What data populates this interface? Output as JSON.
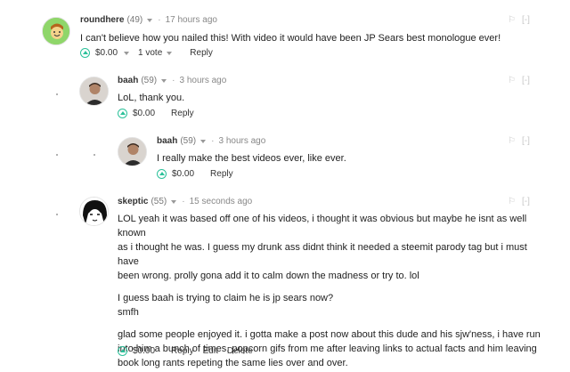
{
  "comments": [
    {
      "author": "roundhere",
      "reputation": "(49)",
      "time": "17 hours ago",
      "paragraphs": [
        "I can't believe how you nailed this! With video it would have been JP Sears best monologue ever!"
      ],
      "payout": "$0.00",
      "votes": "1 vote",
      "actions": [
        "Reply"
      ]
    },
    {
      "author": "baah",
      "reputation": "(59)",
      "time": "3 hours ago",
      "paragraphs": [
        "LoL, thank you."
      ],
      "payout": "$0.00",
      "actions": [
        "Reply"
      ]
    },
    {
      "author": "baah",
      "reputation": "(59)",
      "time": "3 hours ago",
      "paragraphs": [
        "I really make the best videos ever, like ever."
      ],
      "payout": "$0.00",
      "actions": [
        "Reply"
      ]
    },
    {
      "author": "skeptic",
      "reputation": "(55)",
      "time": "15 seconds ago",
      "paragraphs": [
        "LOL yeah it was based off one of his videos, i thought it was obvious but maybe he isnt as well known",
        "as i thought he was. I guess my drunk ass didnt think it needed a steemit parody tag but i must have",
        "been wrong. prolly gona add it to calm down the madness or try to. lol",
        "I guess baah is trying to claim he is jp sears now?",
        "smfh",
        "glad some people enjoyed it. i gotta make a post now about this dude and his sjw'ness, i have run",
        "into him a bunch of times. popcorn gifs from me after leaving links to actual facts and him leaving",
        "book long rants repeting the same lies over and over."
      ],
      "payout": "$0.00",
      "actions": [
        "Reply",
        "Edit",
        "Delete"
      ]
    }
  ],
  "collapse_label": "[-]",
  "colors": {
    "upvote": "#2cc19a",
    "muted": "#888888",
    "text": "#222222"
  }
}
